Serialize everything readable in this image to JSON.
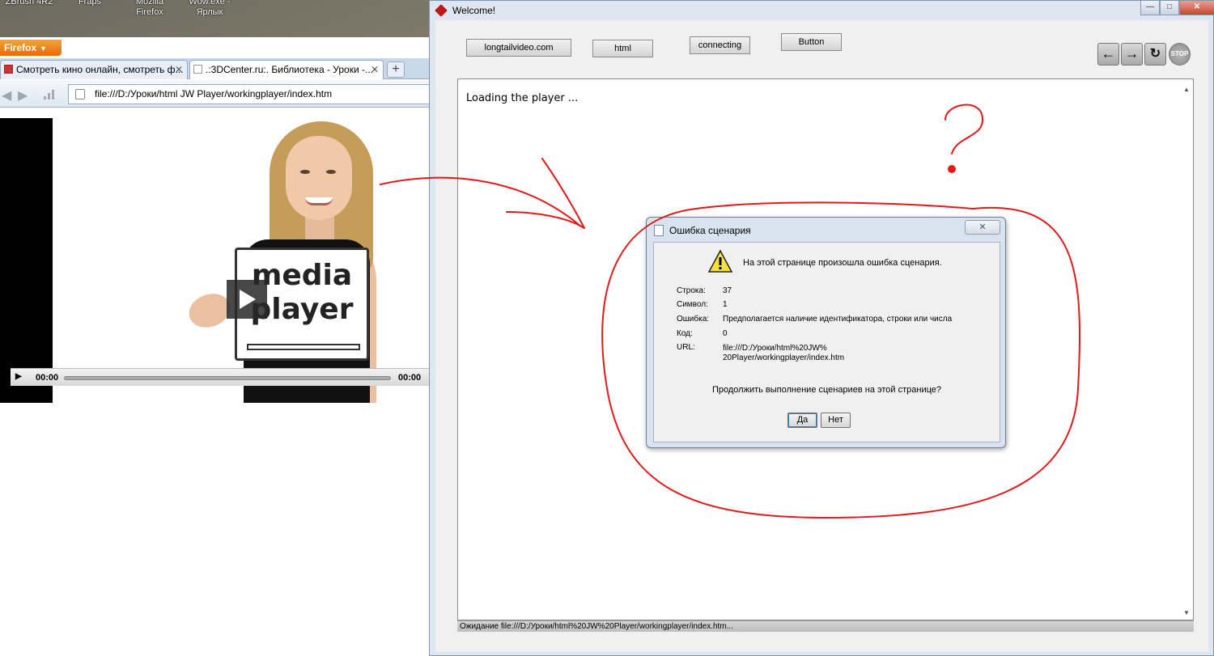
{
  "desktop": {
    "icons": [
      {
        "label": "ZBrush 4R2"
      },
      {
        "label": "Fraps"
      },
      {
        "label": "Mozilla Firefox"
      },
      {
        "label": "Wow.exe - Ярлык"
      }
    ]
  },
  "firefox": {
    "menu_button": "Firefox",
    "tabs": [
      {
        "label": "Смотреть кино онлайн, смотреть ф..."
      },
      {
        "label": ".:3DCenter.ru:. Библиотека - Уроки -..."
      }
    ],
    "address": "file:///D:/Уроки/html JW Player/workingplayer/index.htm",
    "player": {
      "sign_line1": "media",
      "sign_line2": "player",
      "time_elapsed": "00:00",
      "time_total": "00:00"
    }
  },
  "welcome_window": {
    "title": "Welcome!",
    "buttons": {
      "longtail": "longtailvideo.com",
      "html": "html",
      "connecting": "connecting",
      "button": "Button"
    },
    "nav_stop_label": "STOP",
    "loading_text": "Loading the player ...",
    "status_text": "Ожидание file:///D:/Уроки/html%20JW%20Player/workingplayer/index.htm..."
  },
  "script_error_dialog": {
    "title": "Ошибка сценария",
    "message": "На этой странице произошла ошибка сценария.",
    "rows": [
      {
        "label": "Строка:",
        "value": "37"
      },
      {
        "label": "Символ:",
        "value": "1"
      },
      {
        "label": "Ошибка:",
        "value": "Предполагается наличие идентификатора, строки или числа"
      },
      {
        "label": "Код:",
        "value": "0"
      },
      {
        "label": "URL:",
        "value": "file:///D:/Уроки/html%20JW%20Player/workingplayer/index.htm"
      }
    ],
    "url_line1": "file:///D:/Уроки/html%20JW%",
    "url_line2": "20Player/workingplayer/index.htm",
    "question": "Продолжить выполнение сценариев на этой странице?",
    "yes": "Да",
    "no": "Нет"
  }
}
